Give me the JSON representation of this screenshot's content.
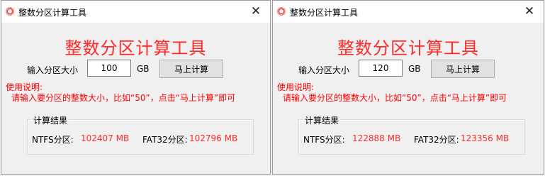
{
  "colors": {
    "heading": "#ff2a2a",
    "usage_text": "#ff0000",
    "result_value": "#ff2a2a",
    "icon": "#d9261c"
  },
  "windows": [
    {
      "title": "整数分区计算工具",
      "icon": "app-icon",
      "close_label": "✕",
      "heading": "整数分区计算工具",
      "size_label": "输入分区大小",
      "size_value": "100",
      "unit": "GB",
      "calc_button": "马上计算",
      "usage_title": "使用说明:",
      "usage_text": "请输入要分区的整数大小，比如“50”，点击“马上计算”即可",
      "result_group": "计算结果",
      "ntfs_label": "NTFS分区:",
      "ntfs_value": "102407 MB",
      "fat32_label": "FAT32分区:",
      "fat32_value": "102796 MB"
    },
    {
      "title": "整数分区计算工具",
      "icon": "app-icon",
      "close_label": "✕",
      "heading": "整数分区计算工具",
      "size_label": "输入分区大小",
      "size_value": "120",
      "unit": "GB",
      "calc_button": "马上计算",
      "usage_title": "使用说明:",
      "usage_text": "请输入要分区的整数大小，比如“50”，点击“马上计算”即可",
      "result_group": "计算结果",
      "ntfs_label": "NTFS分区:",
      "ntfs_value": "122888 MB",
      "fat32_label": "FAT32分区:",
      "fat32_value": "123356 MB"
    }
  ]
}
